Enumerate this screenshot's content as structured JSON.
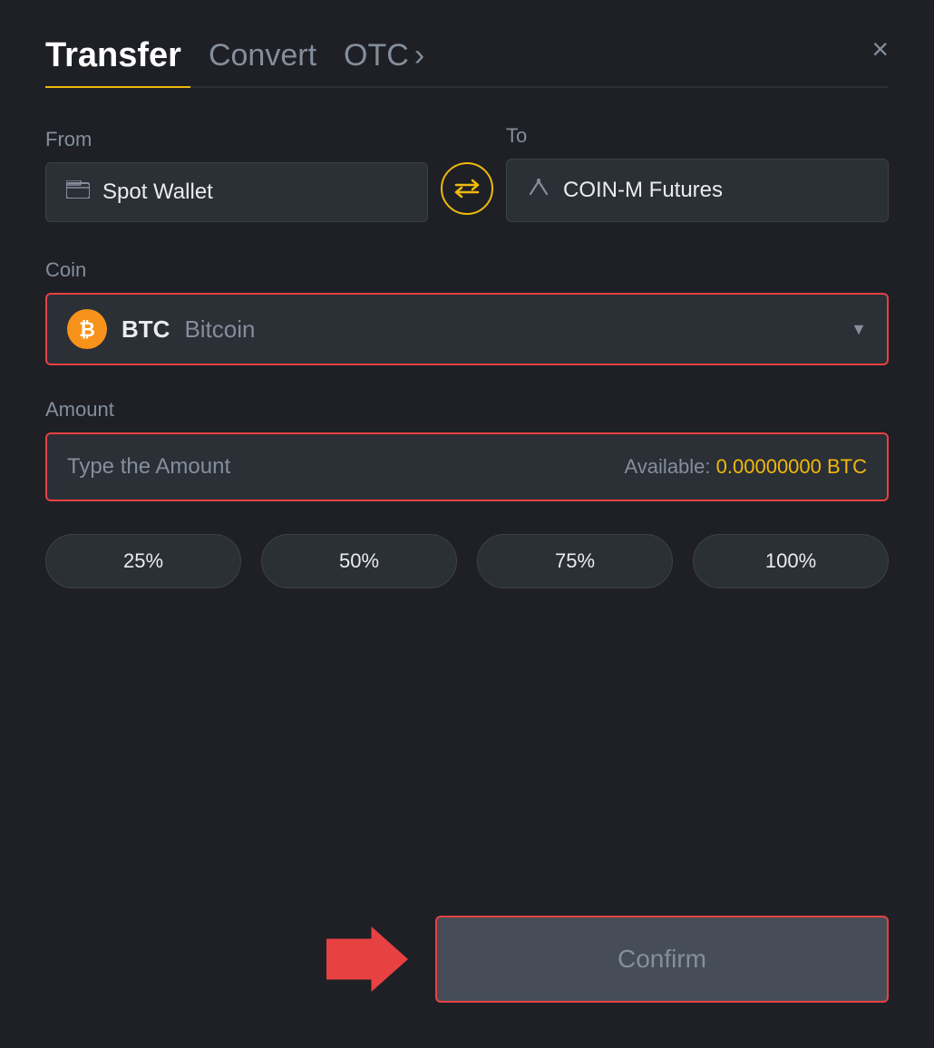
{
  "header": {
    "tab_transfer": "Transfer",
    "tab_convert": "Convert",
    "tab_otc": "OTC",
    "otc_chevron": "›",
    "close_label": "×"
  },
  "from": {
    "label": "From",
    "wallet_icon": "▬",
    "wallet_name": "Spot Wallet"
  },
  "to": {
    "label": "To",
    "wallet_icon": "↑",
    "wallet_name": "COIN-M Futures"
  },
  "swap": {
    "icon": "⇄"
  },
  "coin": {
    "label": "Coin",
    "symbol": "BTC",
    "name": "Bitcoin",
    "btc_letter": "₿"
  },
  "amount": {
    "label": "Amount",
    "placeholder": "Type the Amount",
    "available_label": "Available:",
    "available_value": "0.00000000 BTC"
  },
  "percentages": [
    {
      "label": "25%"
    },
    {
      "label": "50%"
    },
    {
      "label": "75%"
    },
    {
      "label": "100%"
    }
  ],
  "confirm": {
    "label": "Confirm"
  }
}
